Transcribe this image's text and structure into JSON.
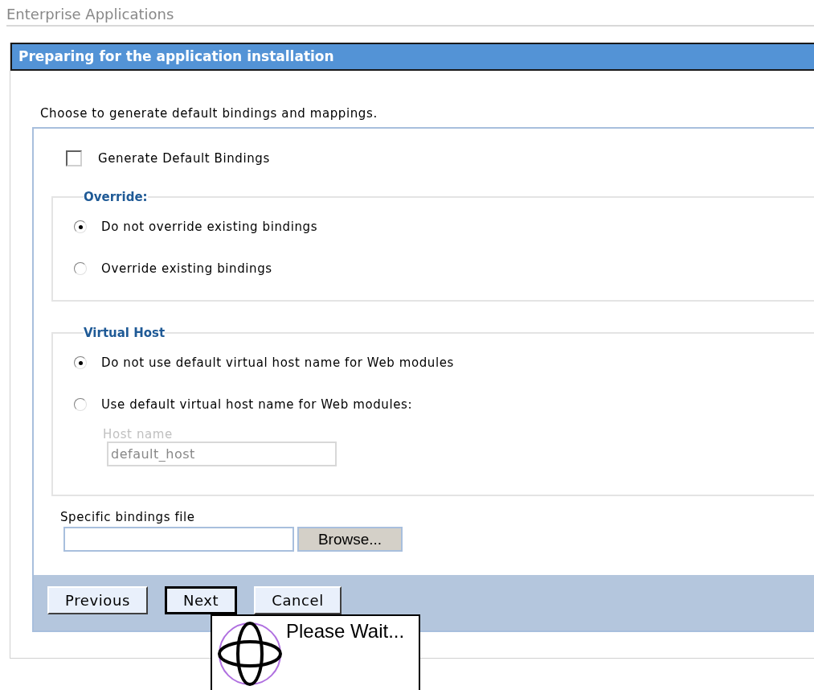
{
  "page_title": "Enterprise Applications",
  "panel": {
    "title": "Preparing for the application installation",
    "description": "Choose to generate default bindings and mappings.",
    "generate_default_bindings": {
      "label": "Generate Default Bindings",
      "checked": false
    },
    "groups": [
      {
        "legend": "Override:",
        "options": [
          {
            "label": "Do not override existing bindings",
            "selected": true
          },
          {
            "label": "Override existing bindings",
            "selected": false
          }
        ]
      },
      {
        "legend": "Virtual Host",
        "options": [
          {
            "label": "Do not use default virtual host name for Web modules",
            "selected": true
          },
          {
            "label": "Use default virtual host name for Web modules:",
            "selected": false
          }
        ],
        "host_name": {
          "label": "Host name",
          "value": "default_host",
          "disabled": true
        }
      }
    ],
    "bindings_file": {
      "label": "Specific bindings file",
      "browse": "Browse..."
    },
    "buttons": [
      {
        "label": "Previous",
        "focused": false
      },
      {
        "label": "Next",
        "focused": true
      },
      {
        "label": "Cancel",
        "focused": false
      }
    ]
  },
  "wait_popup": {
    "message": "Please Wait..."
  }
}
